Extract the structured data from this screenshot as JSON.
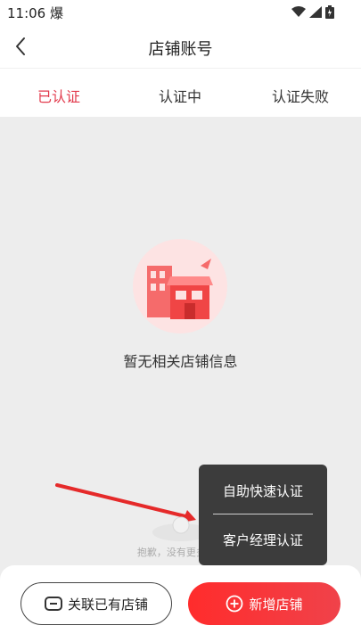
{
  "status_bar": {
    "time": "11:06 爆",
    "icons": [
      "wifi-icon",
      "signal-icon",
      "battery-icon"
    ]
  },
  "header": {
    "title": "店铺账号",
    "back_icon": "chevron-left-icon"
  },
  "tabs": [
    {
      "label": "已认证",
      "active": true
    },
    {
      "label": "认证中",
      "active": false
    },
    {
      "label": "认证失败",
      "active": false
    }
  ],
  "empty_state": {
    "icon": "shop-illustration-icon",
    "message": "暂无相关店铺信息"
  },
  "list_footer": {
    "text": "抱歉，没有更多了~"
  },
  "popup_menu": {
    "items": [
      "自助快速认证",
      "客户经理认证"
    ]
  },
  "bottom_actions": {
    "link_shop": {
      "label": "关联已有店铺",
      "icon": "link-icon"
    },
    "add_shop": {
      "label": "新增店铺",
      "icon": "plus-circle-icon"
    }
  },
  "colors": {
    "accent": "#e23a4c",
    "button_red": "#ff2c2c",
    "popup_bg": "#3c3c3c"
  }
}
